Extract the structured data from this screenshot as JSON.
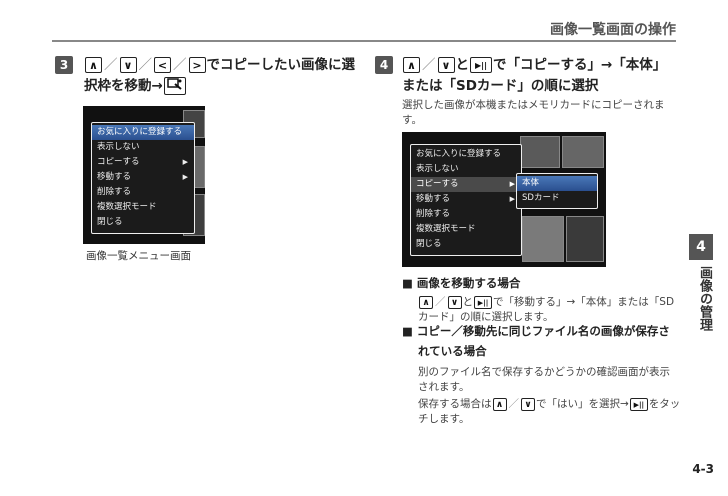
{
  "header": {
    "title": "画像一覧画面の操作"
  },
  "step3": {
    "number": "3",
    "keys": [
      "∧",
      "∨",
      "<",
      ">"
    ],
    "text_after_keys": "でコピーしたい画像に選",
    "line2_prefix": "択枠を移動→",
    "key_menu_icon": "menu-key-icon",
    "menu_items": [
      "お気に入りに登録する",
      "表示しない",
      "コピーする",
      "移動する",
      "削除する",
      "複数選択モード",
      "閉じる"
    ],
    "caption": "画像一覧メニュー画面"
  },
  "step4": {
    "number": "4",
    "line1_mid": "と",
    "line1_after": "で「コピーする」→「本体」",
    "line2": "または「SDカード」の順に選択",
    "desc": "選択した画像が本機またはメモリカードにコピーされます。",
    "menu_items": [
      "お気に入りに登録する",
      "表示しない",
      "コピーする",
      "移動する",
      "削除する",
      "複数選択モード",
      "閉じる"
    ],
    "submenu_items": [
      "本体",
      "SDカード"
    ]
  },
  "notes": {
    "n1_title": "画像を移動する場合",
    "n1_mid": "と",
    "n1_text_a": "で「移動する」→「本体」または「SD",
    "n1_text_b": "カード」の順に選択します。",
    "n2_title_a": "コピー／移動先に同じファイル名の画像が保存さ",
    "n2_title_b": "れている場合",
    "n2_p1": "別のファイル名で保存するかどうかの確認画面が表示されます。",
    "n2_p2_a": "保存する場合は",
    "n2_p2_b": "で「はい」を選択→",
    "n2_p2_c": "をタッ",
    "n2_p2_d": "チします。"
  },
  "sidebar": {
    "chapter_number": "4",
    "chapter_title": "画像の管理"
  },
  "footer": {
    "page_number": "4-3"
  },
  "keys": {
    "up": "∧",
    "down": "∨",
    "left": "<",
    "right": ">",
    "play": "▶||",
    "slash": "／"
  },
  "colors": {
    "accent": "#555555",
    "menu_select": "#3a64a8"
  }
}
